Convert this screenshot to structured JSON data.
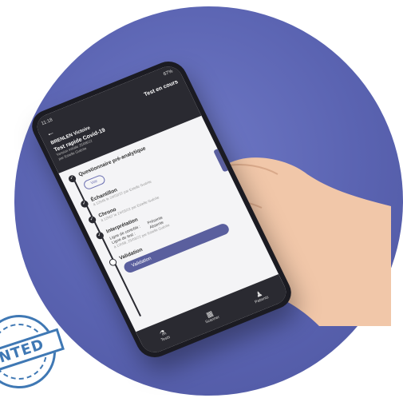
{
  "phone": {
    "status_time": "11:18",
    "status_right": "67%",
    "back_icon": "arrow-left-icon",
    "header_title": "Test en cours",
    "patient_name": "BRENLEN Victoire",
    "test_name": "Test rapide Covid-19",
    "test_meta_1": "Version initiale 25/08/22",
    "test_meta_2": "par Estelle Guérite",
    "steps": [
      {
        "title": "Questionnaire pré-analytique",
        "sub": "",
        "pill": "Voir",
        "done": true
      },
      {
        "title": "Échantillon",
        "sub": "à 12h45 le 24/03/22 par Estelle Guérite",
        "done": true
      },
      {
        "title": "Chrono",
        "sub": "à 12h57 le 24/03/22 par Estelle Guérite",
        "done": true
      },
      {
        "title": "Interprétation",
        "sub": "à 12h58, 25/03/22 par Estelle Guérite",
        "done": true
      },
      {
        "title": "Validation",
        "sub": "",
        "done": false
      }
    ],
    "interp_left_1": "Ligne de contrôle :",
    "interp_left_2": "Ligne de test :",
    "interp_right_1": "Présente",
    "interp_right_2": "Absente",
    "validation_button": "Validation",
    "nav": [
      {
        "label": "Tests",
        "icon": "flask-icon"
      },
      {
        "label": "Scanner",
        "icon": "qr-code-icon"
      },
      {
        "label": "Patients",
        "icon": "users-icon"
      }
    ]
  },
  "stamp_text": "NTED",
  "colors": {
    "background_disc": "#5a63b1",
    "phone_dark": "#2a2a31",
    "accent": "#5a5f9e",
    "stamp": "#3f78b4"
  }
}
